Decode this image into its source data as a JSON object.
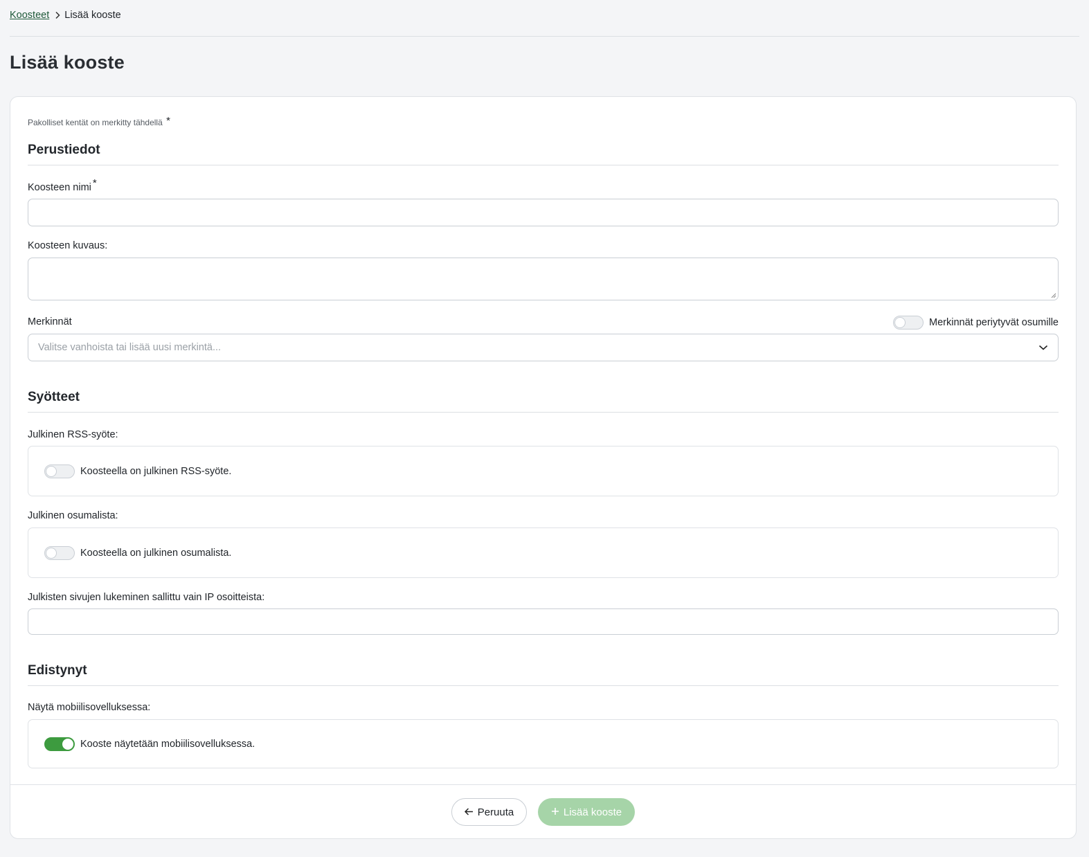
{
  "breadcrumb": {
    "parent": "Koosteet",
    "current": "Lisää kooste"
  },
  "page_title": "Lisää kooste",
  "form": {
    "required_note": "Pakolliset kentät on merkitty tähdellä",
    "required_star": "*",
    "sections": {
      "basic": "Perustiedot",
      "feeds": "Syötteet",
      "advanced": "Edistynyt"
    },
    "name": {
      "label": "Koosteen nimi",
      "value": ""
    },
    "description": {
      "label": "Koosteen kuvaus:",
      "value": ""
    },
    "tags": {
      "label": "Merkinnät",
      "placeholder": "Valitse vanhoista tai lisää uusi merkintä...",
      "inherit_label": "Merkinnät periytyvät osumille",
      "inherit_on": false
    },
    "rss": {
      "label": "Julkinen RSS-syöte:",
      "toggle_label": "Koosteella on julkinen RSS-syöte.",
      "on": false
    },
    "hitlist": {
      "label": "Julkinen osumalista:",
      "toggle_label": "Koosteella on julkinen osumalista.",
      "on": false
    },
    "ip": {
      "label": "Julkisten sivujen lukeminen sallittu vain IP osoitteista:",
      "value": ""
    },
    "mobile": {
      "label": "Näytä mobiilisovelluksessa:",
      "toggle_label": "Kooste näytetään mobiilisovelluksessa.",
      "on": true
    }
  },
  "buttons": {
    "cancel": "Peruuta",
    "submit": "Lisää kooste"
  },
  "colors": {
    "accent": "#3d9b3f",
    "accent_disabled": "#a6d4a8",
    "link": "#1f5a3a"
  }
}
